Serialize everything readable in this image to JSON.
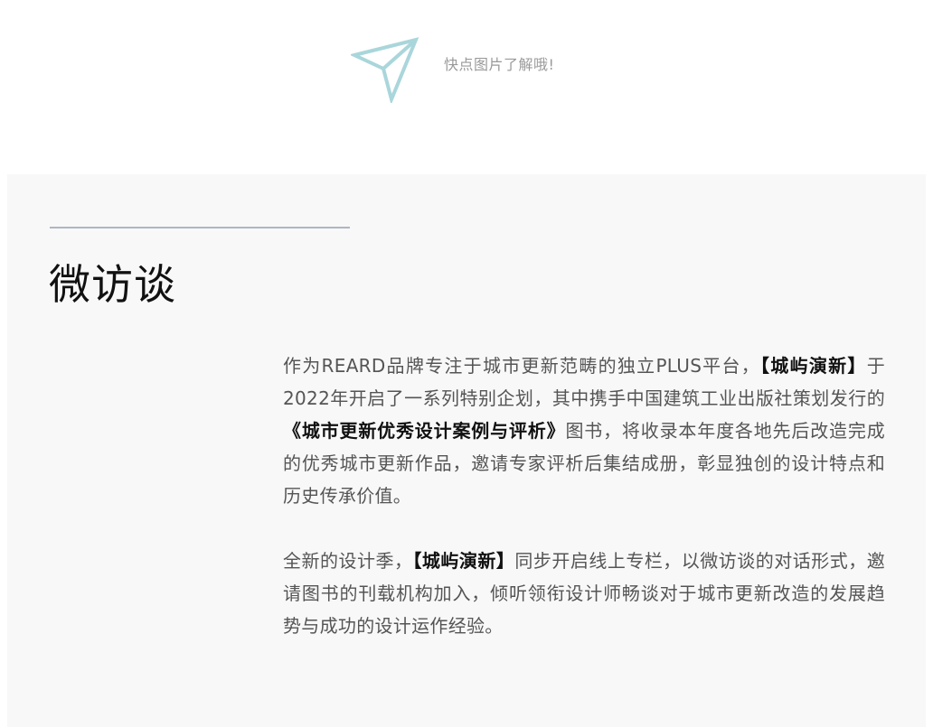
{
  "tip": {
    "icon": "paper-plane-icon",
    "text": "快点图片了解哦!"
  },
  "section": {
    "title": "微访谈"
  },
  "paragraph1": {
    "p1": "作为REARD品牌专注于城市更新范畴的独立PLUS平台，",
    "b1": "【城屿演新】",
    "p2": "于2022年开启了一系列特别企划，其中携手中国建筑工业出版社策划发行的",
    "b2": "《城市更新优秀设计案例与评析》",
    "p3": "图书，将收录本年度各地先后改造完成的优秀城市更新作品，邀请专家评析后集结成册，彰显独创的设计特点和历史传承价值。"
  },
  "paragraph2": {
    "p1": "全新的设计季，",
    "b1": "【城屿演新】",
    "p2": "同步开启线上专栏，以微访谈的对话形式，邀请图书的刊载机构加入，倾听领衔设计师畅谈对于城市更新改造的发展趋势与成功的设计运作经验。"
  },
  "colors": {
    "icon_stroke": "#a9d6db",
    "panel_bg": "#f8f8f8",
    "divider": "#aeb6c2"
  }
}
